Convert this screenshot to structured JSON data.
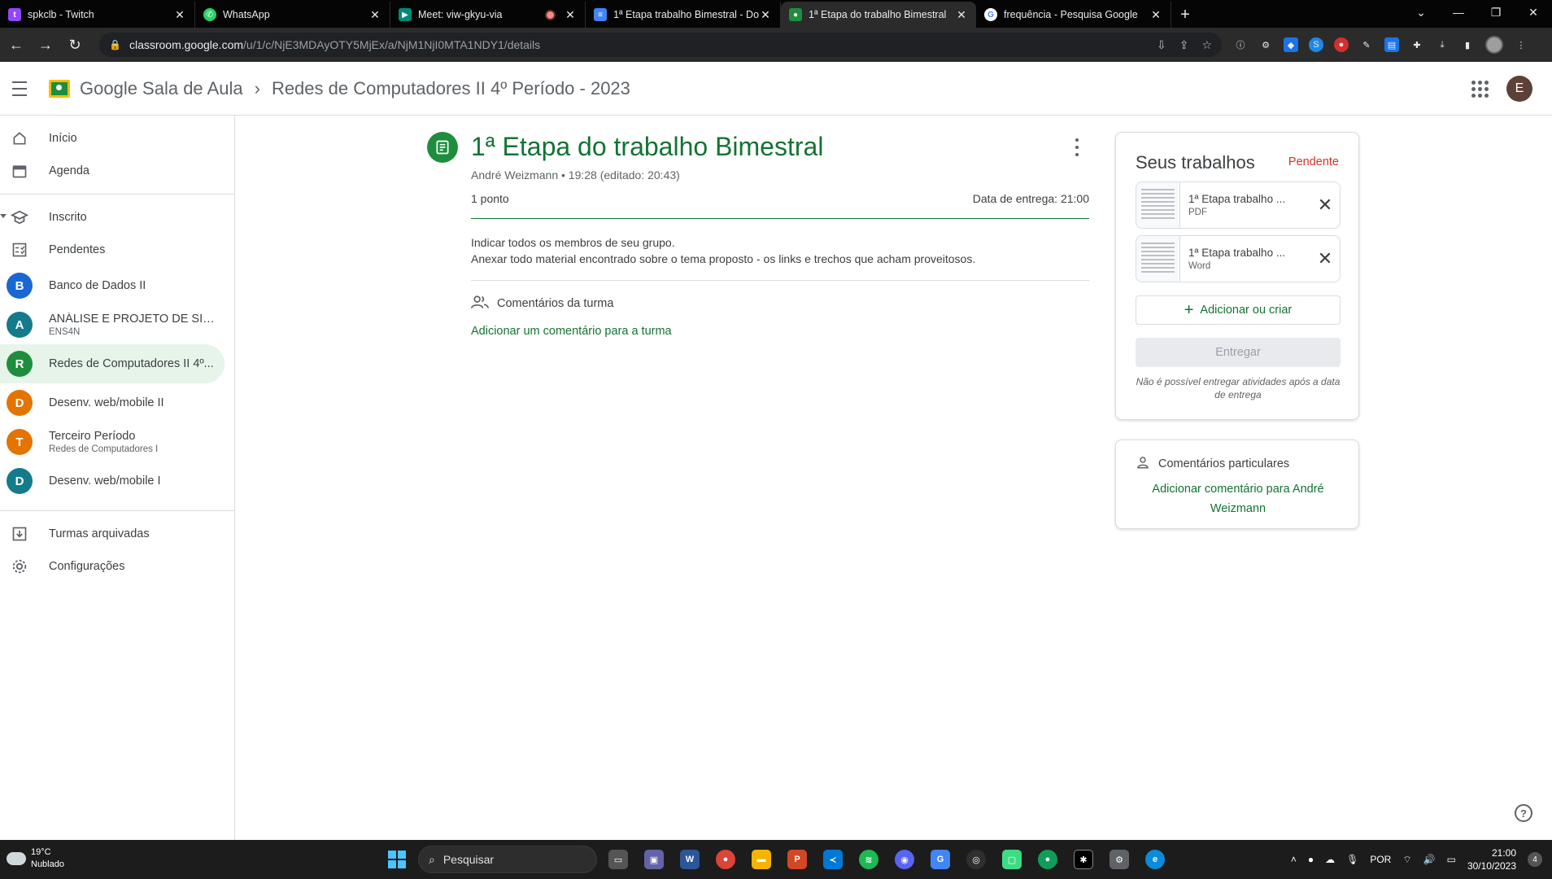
{
  "browser": {
    "tabs": [
      {
        "title": "spkclb - Twitch",
        "favicon": "twitch-icon",
        "color": "#9146ff",
        "active": false
      },
      {
        "title": "WhatsApp",
        "favicon": "whatsapp-icon",
        "color": "#25d366",
        "active": false
      },
      {
        "title": "Meet: viw-gkyu-via",
        "favicon": "meet-icon",
        "color": "#00897b",
        "active": false
      },
      {
        "title": "1ª Etapa trabalho Bimestral - Do",
        "favicon": "docs-icon",
        "color": "#4285f4",
        "active": false
      },
      {
        "title": "1ª Etapa do trabalho Bimestral",
        "favicon": "classroom-icon",
        "color": "#1e8e3e",
        "active": true
      },
      {
        "title": "frequência - Pesquisa Google",
        "favicon": "google-icon",
        "color": "#ffffff",
        "active": false
      }
    ],
    "url_host": "classroom.google.com",
    "url_path": "/u/1/c/NjE3MDAyOTY5MjEx/a/NjM1NjI0MTA1NDY1/details"
  },
  "header": {
    "brand": "Google Sala de Aula",
    "course": "Redes de Computadores II 4º Período - 2023",
    "avatar_letter": "E"
  },
  "sidebar": {
    "top": [
      {
        "label": "Início",
        "icon": "home-icon"
      },
      {
        "label": "Agenda",
        "icon": "calendar-icon"
      }
    ],
    "enrolled": {
      "label": "Inscrito",
      "icon": "school-icon"
    },
    "pending": {
      "label": "Pendentes",
      "icon": "checklist-icon"
    },
    "courses": [
      {
        "letter": "B",
        "name": "Banco de Dados II",
        "sub": "",
        "color": "#1967d2"
      },
      {
        "letter": "A",
        "name": "ANÁLISE E PROJETO DE SIST...",
        "sub": "ENS4N",
        "color": "#137b8a"
      },
      {
        "letter": "R",
        "name": "Redes de Computadores II 4º...",
        "sub": "",
        "color": "#1e8e3e"
      },
      {
        "letter": "D",
        "name": "Desenv. web/mobile II",
        "sub": "",
        "color": "#e37400"
      },
      {
        "letter": "T",
        "name": "Terceiro Período",
        "sub": "Redes de Computadores I",
        "color": "#e37400"
      },
      {
        "letter": "D",
        "name": "Desenv. web/mobile I",
        "sub": "",
        "color": "#137b8a"
      }
    ],
    "bottom": [
      {
        "label": "Turmas arquivadas",
        "icon": "archive-icon"
      },
      {
        "label": "Configurações",
        "icon": "gear-icon"
      }
    ]
  },
  "assignment": {
    "title": "1ª Etapa do trabalho Bimestral",
    "meta": "André Weizmann • 19:28 (editado: 20:43)",
    "points": "1 ponto",
    "due": "Data de entrega: 21:00",
    "description_line1": "Indicar todos os membros de seu grupo.",
    "description_line2": "Anexar todo material encontrado sobre o tema proposto - os links e trechos que acham proveitosos.",
    "class_comments_label": "Comentários da turma",
    "add_class_comment": "Adicionar um comentário para a turma"
  },
  "work": {
    "heading": "Seus trabalhos",
    "status": "Pendente",
    "attachments": [
      {
        "name": "1ª Etapa trabalho ...",
        "type": "PDF"
      },
      {
        "name": "1ª Etapa trabalho ...",
        "type": "Word"
      }
    ],
    "add_label": "Adicionar ou criar",
    "submit_label": "Entregar",
    "note": "Não é possível entregar atividades após a data de entrega"
  },
  "private_comments": {
    "heading": "Comentários particulares",
    "link": "Adicionar comentário para André Weizmann"
  },
  "taskbar": {
    "temp": "19°C",
    "weather": "Nublado",
    "search": "Pesquisar",
    "lang": "POR",
    "time": "21:00",
    "date": "30/10/2023",
    "notifications": "4"
  }
}
